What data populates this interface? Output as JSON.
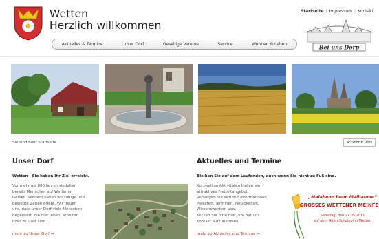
{
  "header": {
    "title_line1": "Wetten",
    "title_line2": "Herzlich willkommen",
    "top_links": [
      "Startseite",
      "Impressum",
      "Kontakt"
    ]
  },
  "nav": {
    "items": [
      "Aktuelles & Termine",
      "Unser Dorf",
      "Gesellige Vereine",
      "Service",
      "Wohnen & Leben"
    ]
  },
  "stamp_text": "Bei uns Dorp",
  "breadcrumb": "Sie sind hier: Startseite",
  "pagesize_button": "A³ Schrift vers",
  "left": {
    "title": "Unser Dorf",
    "lead": "Wetten - Sie haben Ihr Ziel erreicht.",
    "lines": [
      "Vor mehr als 800 Jahren siedelten",
      "bereits Menschen auf Wettener",
      "Gebiet. Seitdem haben wir ruhige und",
      "bewegte Zeiten erlebt. Wir freuen",
      "uns, dass unser Dorf viele Menschen",
      "begeistert, die hier leben, arbeiten",
      "oder zu Gast sind."
    ],
    "more": "mehr zu Unser Dorf →"
  },
  "right": {
    "title": "Aktuelles und Termine",
    "lead": "Bleiben Sie auf dem Laufenden, auch wenn Sie nicht zu Fuß sind.",
    "lines": [
      "Kurzweilige Aktivitäten bieten ein",
      "attraktives Freizeitangebot.",
      "Versorgen Sie sich mit Informationen,",
      "Plakaten, Terminen, Neuigkeiten,",
      "Wissenswertem usw.",
      "Klicken Sie bitte hier, um mit uns",
      "Kontakt aufzunehmen."
    ],
    "more": "mehr zu Aktuelles und Termine →"
  },
  "poster": {
    "line1": "„Maiabend beim Maibaume“",
    "line2": "GROSSES WETTENER MEINFEST",
    "line3": "Samstag, den 27.05.2011",
    "line4": "auf dem Alten Schulhof in Wetten"
  }
}
